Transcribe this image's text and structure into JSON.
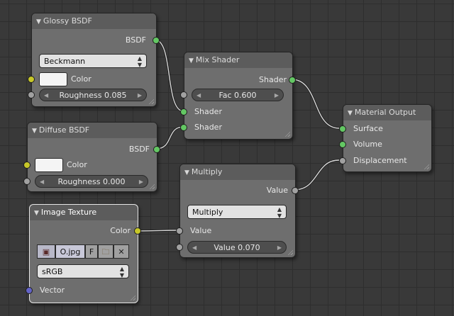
{
  "nodes": {
    "glossy": {
      "title": "Glossy BSDF",
      "output": "BSDF",
      "distribution": "Beckmann",
      "color_label": "Color",
      "roughness": "Roughness 0.085"
    },
    "diffuse": {
      "title": "Diffuse BSDF",
      "output": "BSDF",
      "color_label": "Color",
      "roughness": "Roughness 0.000"
    },
    "mix": {
      "title": "Mix Shader",
      "output": "Shader",
      "fac": "Fac 0.600",
      "input1": "Shader",
      "input2": "Shader"
    },
    "output": {
      "title": "Material Output",
      "surface": "Surface",
      "volume": "Volume",
      "displacement": "Displacement"
    },
    "math": {
      "title": "Multiply",
      "output": "Value",
      "operation": "Multiply",
      "input1": "Value",
      "input2": "Value 0.070"
    },
    "image": {
      "title": "Image Texture",
      "output": "Color",
      "filename": "O.jpg",
      "fake_user": "F",
      "color_space": "sRGB",
      "vector": "Vector"
    }
  },
  "socket_colors": {
    "shader": "#63c763",
    "color": "#c7c729",
    "value": "#a1a1a1",
    "vector": "#6363c7"
  },
  "icons": [
    "collapse-arrow-icon",
    "image-icon",
    "folder-icon",
    "close-icon",
    "dropdown-arrows-icon",
    "resize-handle-icon"
  ]
}
